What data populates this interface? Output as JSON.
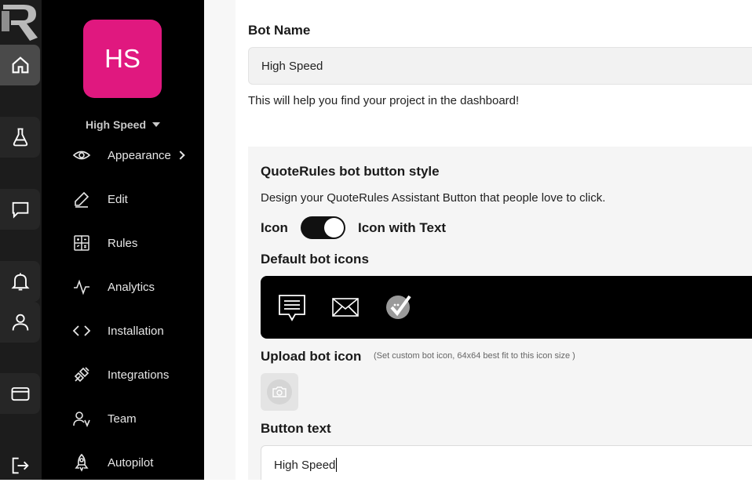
{
  "colors": {
    "avatar_bg": "#e0187f",
    "rail_bg": "#1c1c1c",
    "sidebar_bg": "#000000",
    "toggle_on": "#111111"
  },
  "rail": {
    "logo": "quoterules-logo-icon",
    "items": [
      {
        "icon": "home-icon"
      },
      {
        "icon": "flask-icon"
      },
      {
        "icon": "chat-icon"
      },
      {
        "icon": "bell-icon"
      },
      {
        "icon": "user-icon"
      },
      {
        "icon": "credit-card-icon"
      },
      {
        "icon": "logout-icon"
      }
    ]
  },
  "sidebar": {
    "avatar_initials": "HS",
    "bot_name": "High Speed",
    "items": [
      {
        "label": "Appearance",
        "icon": "eye-icon"
      },
      {
        "label": "Edit",
        "icon": "pencil-icon"
      },
      {
        "label": "Rules",
        "icon": "calculator-icon"
      },
      {
        "label": "Analytics",
        "icon": "activity-icon"
      },
      {
        "label": "Installation",
        "icon": "code-icon"
      },
      {
        "label": "Integrations",
        "icon": "plug-icon"
      },
      {
        "label": "Team",
        "icon": "team-icon"
      },
      {
        "label": "Autopilot",
        "icon": "rocket-icon"
      }
    ]
  },
  "main": {
    "bot_name_label": "Bot Name",
    "bot_name_value": "High Speed",
    "bot_name_helper": "This will help you find your project in the dashboard!",
    "style_title": "QuoteRules bot button style",
    "style_desc": "Design your QuoteRules Assistant Button that people love to click.",
    "toggle_left": "Icon",
    "toggle_right": "Icon with Text",
    "toggle_on": true,
    "default_icons_label": "Default bot icons",
    "default_icons": [
      "message-lines-icon",
      "envelope-icon",
      "check-bubble-icon"
    ],
    "upload_label": "Upload bot icon",
    "upload_hint": "(Set custom bot icon, 64x64 best fit to this icon size )",
    "button_text_label": "Button text",
    "button_text_value": "High Speed"
  }
}
